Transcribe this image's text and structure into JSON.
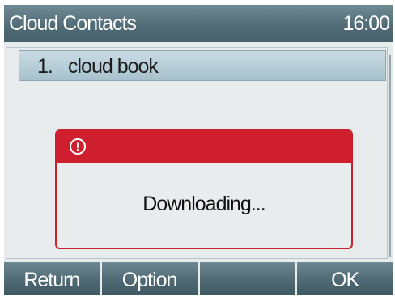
{
  "title_bar": {
    "title": "Cloud Contacts",
    "time": "16:00"
  },
  "list": {
    "items": [
      {
        "index": "1.",
        "label": "cloud book"
      }
    ]
  },
  "dialog": {
    "icon": "alert-circle-icon",
    "icon_glyph": "!",
    "message": "Downloading..."
  },
  "softkeys": {
    "keys": [
      {
        "label": "Return"
      },
      {
        "label": "Option"
      },
      {
        "label": ""
      },
      {
        "label": "OK"
      }
    ]
  },
  "colors": {
    "title_bar": "#506b75",
    "dialog_accent": "#cf1f2f",
    "selection": "#b7ced8",
    "background": "#e7ebeb"
  }
}
